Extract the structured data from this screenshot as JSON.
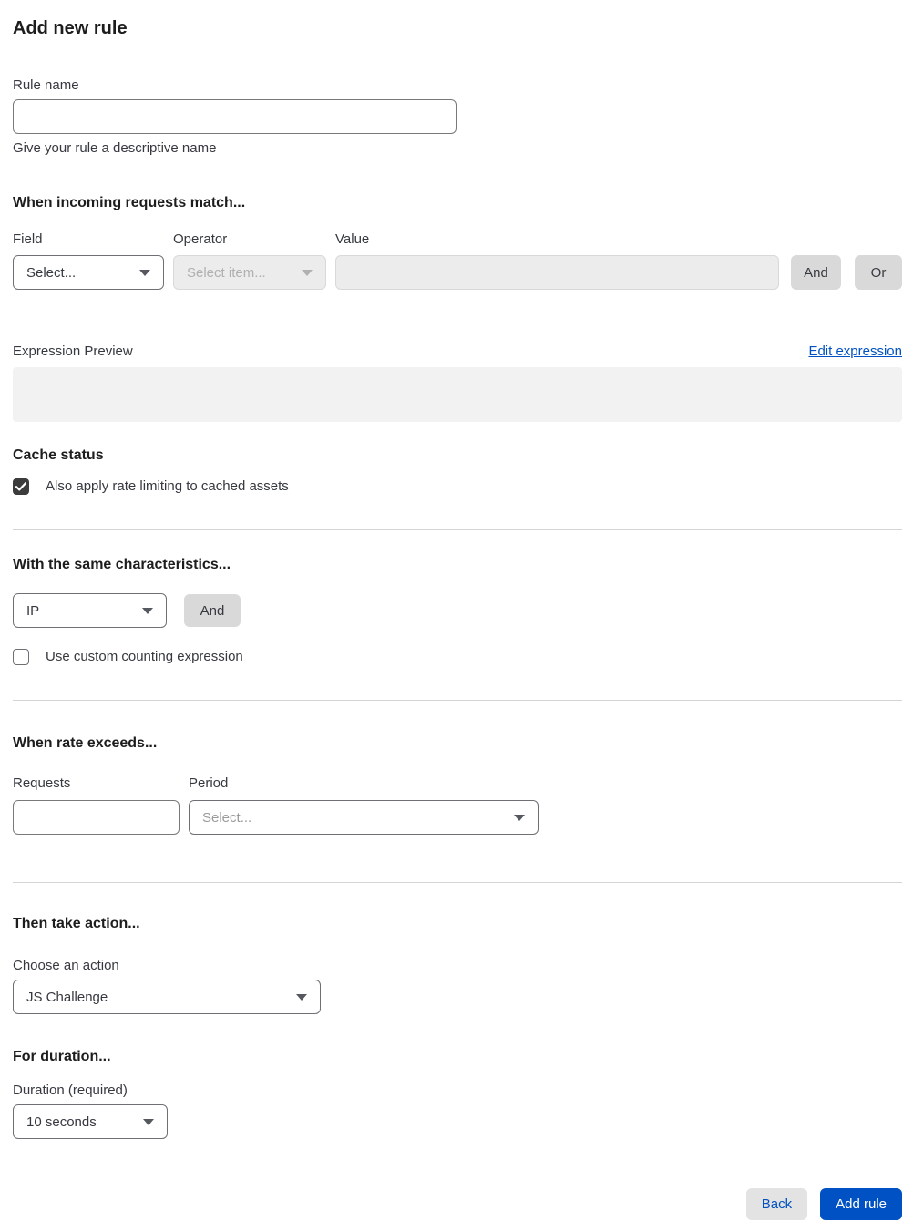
{
  "page": {
    "title": "Add new rule"
  },
  "rule_name": {
    "label": "Rule name",
    "value": "",
    "helper": "Give your rule a descriptive name"
  },
  "match_section": {
    "heading": "When incoming requests match...",
    "field": {
      "label": "Field",
      "selected": "Select..."
    },
    "operator": {
      "label": "Operator",
      "selected": "Select item..."
    },
    "value": {
      "label": "Value",
      "value": ""
    },
    "and_button": "And",
    "or_button": "Or",
    "expression_preview_label": "Expression Preview",
    "edit_expression_link": "Edit expression",
    "expression_value": ""
  },
  "cache_section": {
    "heading": "Cache status",
    "checkbox_label": "Also apply rate limiting to cached assets",
    "checked": true
  },
  "characteristics_section": {
    "heading": "With the same characteristics...",
    "characteristic_selected": "IP",
    "and_button": "And",
    "checkbox_label": "Use custom counting expression",
    "checked": false
  },
  "rate_section": {
    "heading": "When rate exceeds...",
    "requests": {
      "label": "Requests",
      "value": ""
    },
    "period": {
      "label": "Period",
      "selected": "Select..."
    }
  },
  "action_section": {
    "heading": "Then take action...",
    "label": "Choose an action",
    "selected": "JS Challenge"
  },
  "duration_section": {
    "heading": "For duration...",
    "label": "Duration (required)",
    "selected": "10 seconds"
  },
  "footer": {
    "back_button": "Back",
    "add_rule_button": "Add rule"
  },
  "colors": {
    "accent_blue": "#0051c3",
    "button_grey": "#d9d9d9",
    "disabled_bg": "#ececec",
    "checkbox_dark": "#3c3c3c",
    "divider": "#d5d5d5"
  }
}
